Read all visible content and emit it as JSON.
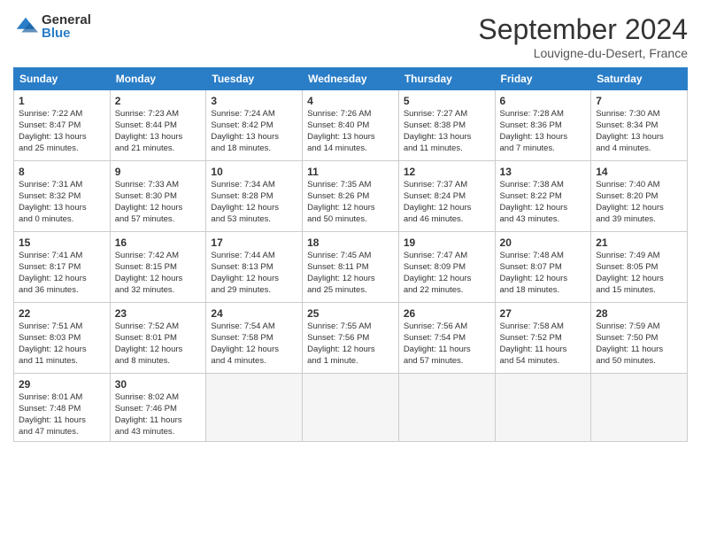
{
  "logo": {
    "general": "General",
    "blue": "Blue"
  },
  "title": "September 2024",
  "location": "Louvigne-du-Desert, France",
  "days": [
    "Sunday",
    "Monday",
    "Tuesday",
    "Wednesday",
    "Thursday",
    "Friday",
    "Saturday"
  ],
  "cells": [
    {
      "day": "",
      "empty": true
    },
    {
      "day": "",
      "empty": true
    },
    {
      "day": "",
      "empty": true
    },
    {
      "day": "",
      "empty": true
    },
    {
      "day": "",
      "empty": true
    },
    {
      "day": "",
      "empty": true
    },
    {
      "day": "7",
      "sunrise": "Sunrise: 7:30 AM",
      "sunset": "Sunset: 8:34 PM",
      "daylight": "Daylight: 13 hours",
      "minutes": "and 4 minutes."
    },
    {
      "day": "8",
      "sunrise": "Sunrise: 7:31 AM",
      "sunset": "Sunset: 8:32 PM",
      "daylight": "Daylight: 13 hours",
      "minutes": "and 0 minutes."
    },
    {
      "day": "9",
      "sunrise": "Sunrise: 7:33 AM",
      "sunset": "Sunset: 8:30 PM",
      "daylight": "Daylight: 12 hours",
      "minutes": "and 57 minutes."
    },
    {
      "day": "10",
      "sunrise": "Sunrise: 7:34 AM",
      "sunset": "Sunset: 8:28 PM",
      "daylight": "Daylight: 12 hours",
      "minutes": "and 53 minutes."
    },
    {
      "day": "11",
      "sunrise": "Sunrise: 7:35 AM",
      "sunset": "Sunset: 8:26 PM",
      "daylight": "Daylight: 12 hours",
      "minutes": "and 50 minutes."
    },
    {
      "day": "12",
      "sunrise": "Sunrise: 7:37 AM",
      "sunset": "Sunset: 8:24 PM",
      "daylight": "Daylight: 12 hours",
      "minutes": "and 46 minutes."
    },
    {
      "day": "13",
      "sunrise": "Sunrise: 7:38 AM",
      "sunset": "Sunset: 8:22 PM",
      "daylight": "Daylight: 12 hours",
      "minutes": "and 43 minutes."
    },
    {
      "day": "14",
      "sunrise": "Sunrise: 7:40 AM",
      "sunset": "Sunset: 8:20 PM",
      "daylight": "Daylight: 12 hours",
      "minutes": "and 39 minutes."
    },
    {
      "day": "15",
      "sunrise": "Sunrise: 7:41 AM",
      "sunset": "Sunset: 8:17 PM",
      "daylight": "Daylight: 12 hours",
      "minutes": "and 36 minutes."
    },
    {
      "day": "16",
      "sunrise": "Sunrise: 7:42 AM",
      "sunset": "Sunset: 8:15 PM",
      "daylight": "Daylight: 12 hours",
      "minutes": "and 32 minutes."
    },
    {
      "day": "17",
      "sunrise": "Sunrise: 7:44 AM",
      "sunset": "Sunset: 8:13 PM",
      "daylight": "Daylight: 12 hours",
      "minutes": "and 29 minutes."
    },
    {
      "day": "18",
      "sunrise": "Sunrise: 7:45 AM",
      "sunset": "Sunset: 8:11 PM",
      "daylight": "Daylight: 12 hours",
      "minutes": "and 25 minutes."
    },
    {
      "day": "19",
      "sunrise": "Sunrise: 7:47 AM",
      "sunset": "Sunset: 8:09 PM",
      "daylight": "Daylight: 12 hours",
      "minutes": "and 22 minutes."
    },
    {
      "day": "20",
      "sunrise": "Sunrise: 7:48 AM",
      "sunset": "Sunset: 8:07 PM",
      "daylight": "Daylight: 12 hours",
      "minutes": "and 18 minutes."
    },
    {
      "day": "21",
      "sunrise": "Sunrise: 7:49 AM",
      "sunset": "Sunset: 8:05 PM",
      "daylight": "Daylight: 12 hours",
      "minutes": "and 15 minutes."
    },
    {
      "day": "22",
      "sunrise": "Sunrise: 7:51 AM",
      "sunset": "Sunset: 8:03 PM",
      "daylight": "Daylight: 12 hours",
      "minutes": "and 11 minutes."
    },
    {
      "day": "23",
      "sunrise": "Sunrise: 7:52 AM",
      "sunset": "Sunset: 8:01 PM",
      "daylight": "Daylight: 12 hours",
      "minutes": "and 8 minutes."
    },
    {
      "day": "24",
      "sunrise": "Sunrise: 7:54 AM",
      "sunset": "Sunset: 7:58 PM",
      "daylight": "Daylight: 12 hours",
      "minutes": "and 4 minutes."
    },
    {
      "day": "25",
      "sunrise": "Sunrise: 7:55 AM",
      "sunset": "Sunset: 7:56 PM",
      "daylight": "Daylight: 12 hours",
      "minutes": "and 1 minute."
    },
    {
      "day": "26",
      "sunrise": "Sunrise: 7:56 AM",
      "sunset": "Sunset: 7:54 PM",
      "daylight": "Daylight: 11 hours",
      "minutes": "and 57 minutes."
    },
    {
      "day": "27",
      "sunrise": "Sunrise: 7:58 AM",
      "sunset": "Sunset: 7:52 PM",
      "daylight": "Daylight: 11 hours",
      "minutes": "and 54 minutes."
    },
    {
      "day": "28",
      "sunrise": "Sunrise: 7:59 AM",
      "sunset": "Sunset: 7:50 PM",
      "daylight": "Daylight: 11 hours",
      "minutes": "and 50 minutes."
    },
    {
      "day": "29",
      "sunrise": "Sunrise: 8:01 AM",
      "sunset": "Sunset: 7:48 PM",
      "daylight": "Daylight: 11 hours",
      "minutes": "and 47 minutes."
    },
    {
      "day": "30",
      "sunrise": "Sunrise: 8:02 AM",
      "sunset": "Sunset: 7:46 PM",
      "daylight": "Daylight: 11 hours",
      "minutes": "and 43 minutes."
    },
    {
      "day": "",
      "empty": true
    },
    {
      "day": "",
      "empty": true
    },
    {
      "day": "",
      "empty": true
    },
    {
      "day": "",
      "empty": true
    },
    {
      "day": "",
      "empty": true
    }
  ],
  "row1": [
    {
      "day": "1",
      "sunrise": "Sunrise: 7:22 AM",
      "sunset": "Sunset: 8:47 PM",
      "daylight": "Daylight: 13 hours",
      "minutes": "and 25 minutes."
    },
    {
      "day": "2",
      "sunrise": "Sunrise: 7:23 AM",
      "sunset": "Sunset: 8:44 PM",
      "daylight": "Daylight: 13 hours",
      "minutes": "and 21 minutes."
    },
    {
      "day": "3",
      "sunrise": "Sunrise: 7:24 AM",
      "sunset": "Sunset: 8:42 PM",
      "daylight": "Daylight: 13 hours",
      "minutes": "and 18 minutes."
    },
    {
      "day": "4",
      "sunrise": "Sunrise: 7:26 AM",
      "sunset": "Sunset: 8:40 PM",
      "daylight": "Daylight: 13 hours",
      "minutes": "and 14 minutes."
    },
    {
      "day": "5",
      "sunrise": "Sunrise: 7:27 AM",
      "sunset": "Sunset: 8:38 PM",
      "daylight": "Daylight: 13 hours",
      "minutes": "and 11 minutes."
    },
    {
      "day": "6",
      "sunrise": "Sunrise: 7:28 AM",
      "sunset": "Sunset: 8:36 PM",
      "daylight": "Daylight: 13 hours",
      "minutes": "and 7 minutes."
    }
  ]
}
